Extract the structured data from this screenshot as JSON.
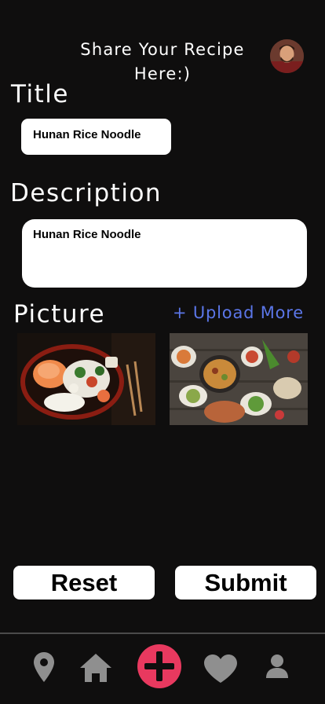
{
  "header": {
    "title": "Share Your Recipe Here:)"
  },
  "form": {
    "title_label": "Title",
    "title_value": "Hunan Rice Noodle",
    "description_label": "Description",
    "description_value": "Hunan Rice Noodle",
    "picture_label": "Picture",
    "upload_more_label": "+ Upload More"
  },
  "photos": [
    {
      "icon": "sushi-platter-photo"
    },
    {
      "icon": "food-spread-photo"
    }
  ],
  "actions": {
    "reset_label": "Reset",
    "submit_label": "Submit"
  },
  "bottom_nav": {
    "items": [
      {
        "icon": "location-pin-icon"
      },
      {
        "icon": "home-icon"
      },
      {
        "icon": "add-icon"
      },
      {
        "icon": "heart-icon"
      },
      {
        "icon": "profile-icon"
      }
    ]
  },
  "colors": {
    "background": "#0f0e0e",
    "accent_link": "#5b76e8",
    "add_button": "#e8395f",
    "nav_icon": "#8f8f8f"
  }
}
